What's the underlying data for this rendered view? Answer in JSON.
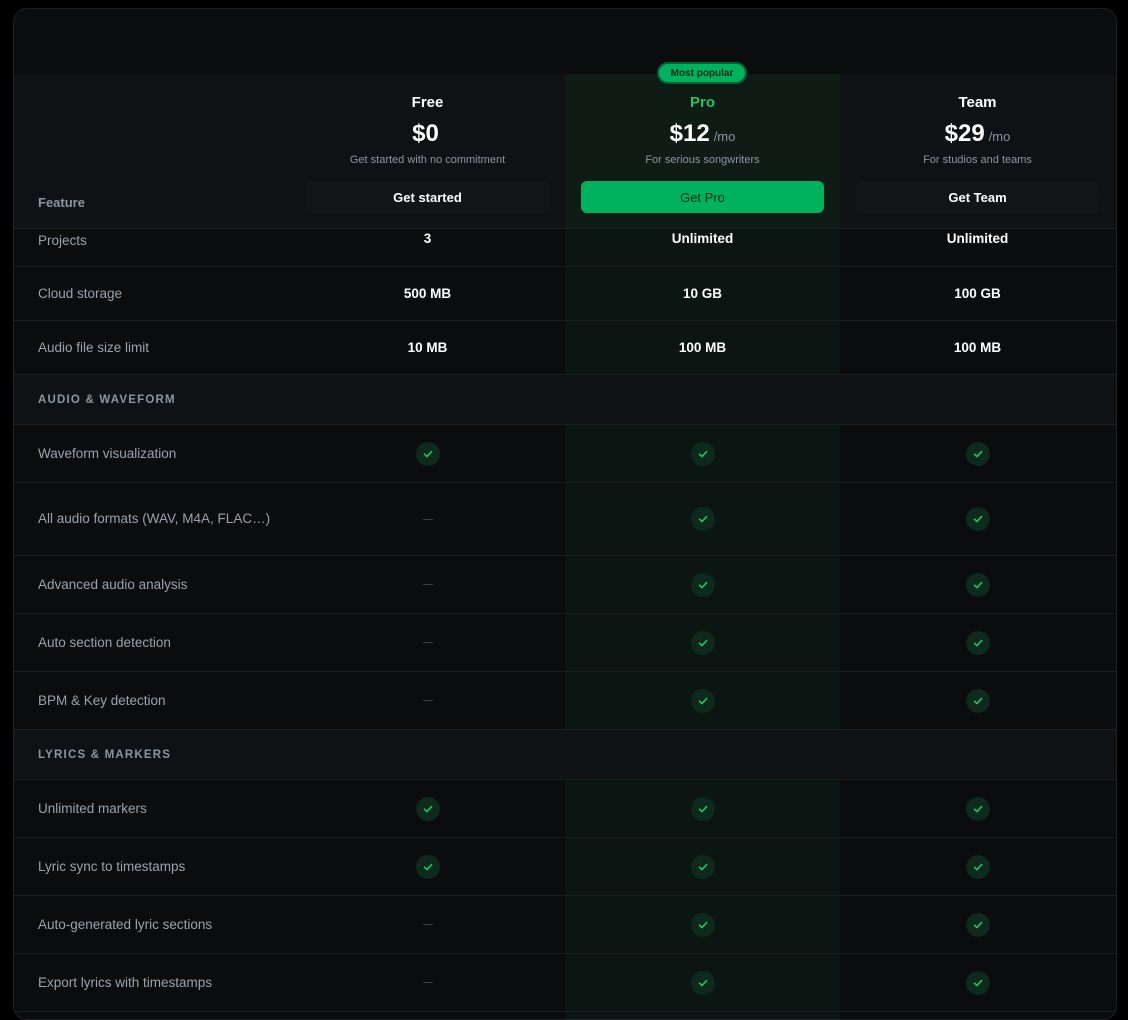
{
  "table": {
    "feature_header": "Feature",
    "plans": [
      {
        "name": "Free",
        "price": "$0",
        "period": "",
        "description": "Get started with no commitment",
        "cta": "Get started",
        "highlight": false
      },
      {
        "name": "Pro",
        "price": "$12",
        "period": "/mo",
        "description": "For serious songwriters",
        "cta": "Get Pro",
        "highlight": true,
        "badge": "Most popular"
      },
      {
        "name": "Team",
        "price": "$29",
        "period": "/mo",
        "description": "For studios and teams",
        "cta": "Get Team",
        "highlight": false
      }
    ],
    "accent_color": "#00b15e",
    "rows": [
      {
        "type": "feature",
        "label": "Projects",
        "values": [
          "3",
          "Unlimited",
          "Unlimited"
        ]
      },
      {
        "type": "feature",
        "label": "Cloud storage",
        "values": [
          "500 MB",
          "10 GB",
          "100 GB"
        ]
      },
      {
        "type": "feature",
        "label": "Audio file size limit",
        "values": [
          "10 MB",
          "100 MB",
          "100 MB"
        ]
      },
      {
        "type": "section",
        "label": "AUDIO & WAVEFORM"
      },
      {
        "type": "feature",
        "label": "Waveform visualization",
        "values": [
          true,
          true,
          true
        ]
      },
      {
        "type": "feature",
        "label": "All audio formats (WAV, M4A, FLAC…)",
        "values": [
          false,
          true,
          true
        ]
      },
      {
        "type": "feature",
        "label": "Advanced audio analysis",
        "values": [
          false,
          true,
          true
        ]
      },
      {
        "type": "feature",
        "label": "Auto section detection",
        "values": [
          false,
          true,
          true
        ]
      },
      {
        "type": "feature",
        "label": "BPM & Key detection",
        "values": [
          false,
          true,
          true
        ]
      },
      {
        "type": "section",
        "label": "LYRICS & MARKERS"
      },
      {
        "type": "feature",
        "label": "Unlimited markers",
        "values": [
          true,
          true,
          true
        ]
      },
      {
        "type": "feature",
        "label": "Lyric sync to timestamps",
        "values": [
          true,
          true,
          true
        ]
      },
      {
        "type": "feature",
        "label": "Auto-generated lyric sections",
        "values": [
          false,
          true,
          true
        ]
      },
      {
        "type": "feature",
        "label": "Export lyrics with timestamps",
        "values": [
          false,
          true,
          true
        ]
      }
    ]
  }
}
